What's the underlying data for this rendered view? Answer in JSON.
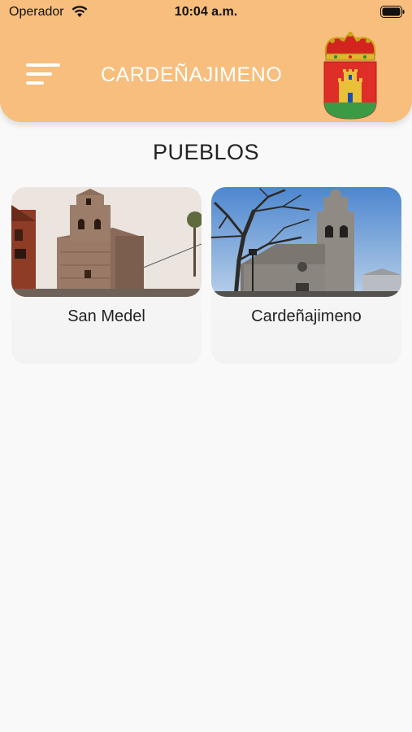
{
  "status_bar": {
    "carrier": "Operador",
    "time": "10:04 a.m.",
    "wifi_icon": "wifi-icon",
    "battery_icon": "battery-icon"
  },
  "header": {
    "title": "CARDEÑAJIMENO",
    "menu_icon": "menu-icon",
    "background_color": "#f7be7d",
    "emblem": "coat-of-arms"
  },
  "section": {
    "title": "PUEBLOS"
  },
  "towns": [
    {
      "name": "San Medel"
    },
    {
      "name": "Cardeñajimeno"
    }
  ]
}
